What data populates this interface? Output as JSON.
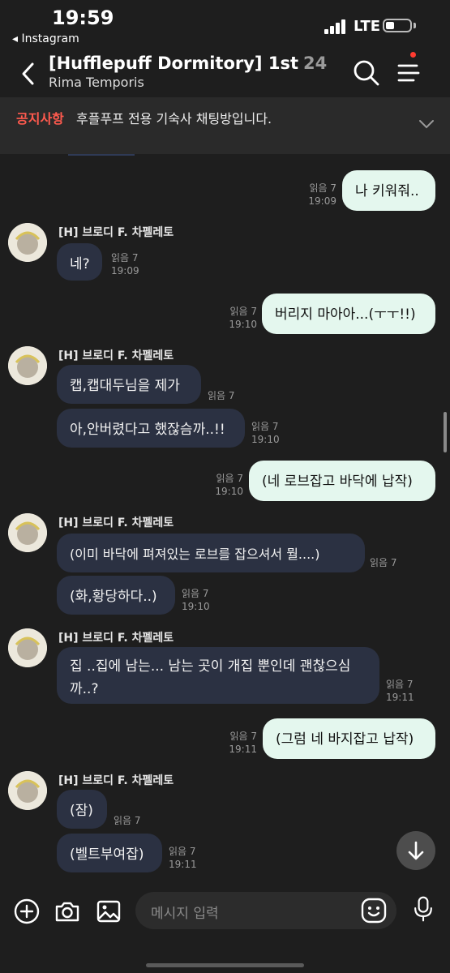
{
  "status_bar": {
    "time": "19:59",
    "back_app": "◂ Instagram",
    "network": "LTE"
  },
  "header": {
    "title": "[Hufflepuff Dormitory] 1st",
    "member_count": "24",
    "subtitle": "Rima Temporis"
  },
  "notice": {
    "label": "공지사항",
    "text": "후플푸프 전용 기숙사 채팅방입니다."
  },
  "sender_name": "[H] 브로디 F. 차펠레토",
  "messages": [
    {
      "id": "m1",
      "from": "me",
      "text": "나 키워줘..",
      "read": "읽음 7",
      "time": "19:09"
    },
    {
      "id": "m2",
      "from": "other",
      "text": "네?",
      "read": "읽음 7",
      "time": "19:09"
    },
    {
      "id": "m3",
      "from": "me",
      "text": "버리지 마아아...(ㅜㅜ!!)",
      "read": "읽음 7",
      "time": "19:10"
    },
    {
      "id": "m4",
      "from": "other",
      "text": "캡,캡대두님을 제가",
      "read": "읽음 7",
      "time": ""
    },
    {
      "id": "m5",
      "from": "other",
      "text": "아,안버렸다고 했잖슴까..!!",
      "read": "읽음 7",
      "time": "19:10"
    },
    {
      "id": "m6",
      "from": "me",
      "text": "(네 로브잡고 바닥에 납작)",
      "read": "읽음 7",
      "time": "19:10"
    },
    {
      "id": "m7",
      "from": "other",
      "text": "(이미 바닥에 펴져있는 로브를 잡으셔서 뭘....)",
      "read": "읽음 7",
      "time": ""
    },
    {
      "id": "m8",
      "from": "other",
      "text": "(화,황당하다..)",
      "read": "읽음 7",
      "time": "19:10"
    },
    {
      "id": "m9",
      "from": "other",
      "text": "집 ..집에 남는... 남는 곳이 개집 뿐인데 괜찮으심까..?",
      "read": "읽음 7",
      "time": "19:11"
    },
    {
      "id": "m10",
      "from": "me",
      "text": "(그럼 네 바지잡고 납작)",
      "read": "읽음 7",
      "time": "19:11"
    },
    {
      "id": "m11",
      "from": "other",
      "text": "(잠)",
      "read": "읽음 7",
      "time": ""
    },
    {
      "id": "m12",
      "from": "other",
      "text": "(벨트부여잡)",
      "read": "읽음 7",
      "time": "19:11"
    }
  ],
  "input": {
    "placeholder": "메시지 입력"
  },
  "colors": {
    "background": "#1e1e1e",
    "my_bubble": "#e4f7ee",
    "their_bubble": "#2b3142",
    "notice_label": "#ff5a4e"
  },
  "icons": [
    "back-chevron-icon",
    "search-icon",
    "menu-icon",
    "chevron-down-icon",
    "plus-icon",
    "camera-icon",
    "image-icon",
    "emoji-icon",
    "microphone-icon",
    "arrow-down-icon"
  ]
}
